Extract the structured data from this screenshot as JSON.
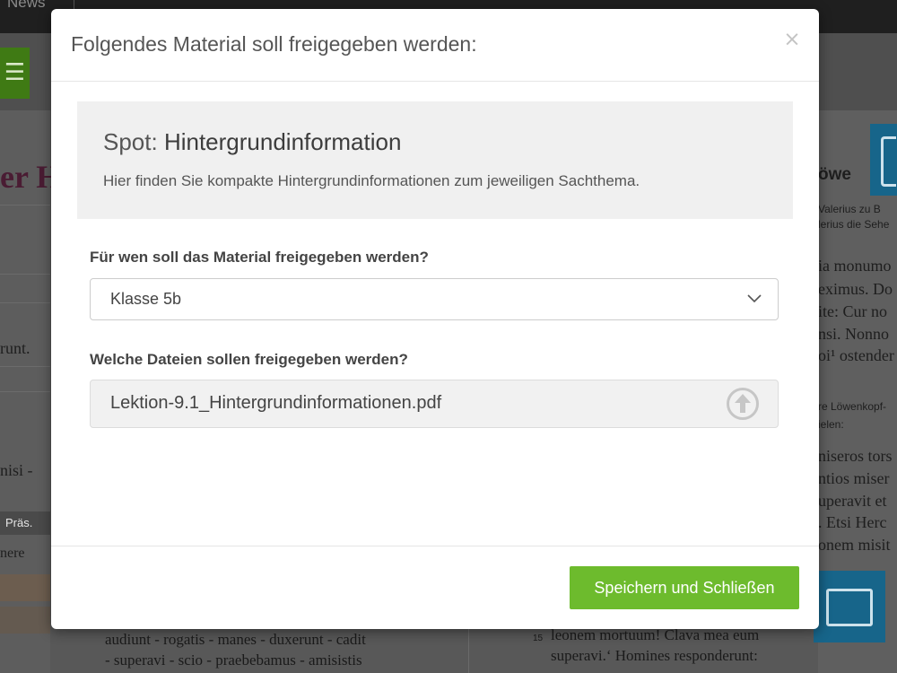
{
  "background": {
    "nav": {
      "news_label": "News"
    },
    "left_column": {
      "title_fragment": "er H",
      "text_1": "runt.",
      "text_2": "nisi -",
      "table_header": "Präs.",
      "table_cell": "nere"
    },
    "right_column": {
      "heading": "öwe",
      "small_1": "Valerius zu B",
      "small_2": "lerius die Sehe",
      "lines_a": [
        "ia monumo",
        "eximus. Do",
        "ite: Cur no",
        "nsi. Nonno",
        "oi¹ ostender"
      ],
      "small_3": "re Löwenkopf-",
      "small_4": "ielen:",
      "lines_b": [
        "niseros tors",
        "ntios miser",
        "uperavit et",
        ". Etsi Herc",
        "onem misit"
      ]
    },
    "bottom": {
      "left_line_1": "audiunt - rogatis - manes - duxerunt - cadit",
      "left_line_2": "- superavi - scio - praebebamus - amisistis",
      "line_number": "15",
      "right_line_1": "leonem mortuum! Clava mea eum",
      "right_line_2": "superavi.‘ Homines responderunt:"
    }
  },
  "modal": {
    "title": "Folgendes Material soll freigegeben werden:",
    "close_symbol": "×",
    "info": {
      "prefix": "Spot: ",
      "name": "Hintergrundinformation",
      "description": "Hier finden Sie kompakte Hintergrundinformationen zum jeweiligen Sachthema."
    },
    "recipient": {
      "label": "Für wen soll das Material freigegeben werden?",
      "selected": "Klasse 5b"
    },
    "files": {
      "label": "Welche Dateien sollen freigegeben werden?",
      "file_name": "Lektion-9.1_Hintergrundinformationen.pdf"
    },
    "save_label": "Speichern und Schließen"
  },
  "colors": {
    "accent_green": "#6dbb2d",
    "overlay": "#5a5a5a",
    "blue_icon": "#17658a"
  }
}
